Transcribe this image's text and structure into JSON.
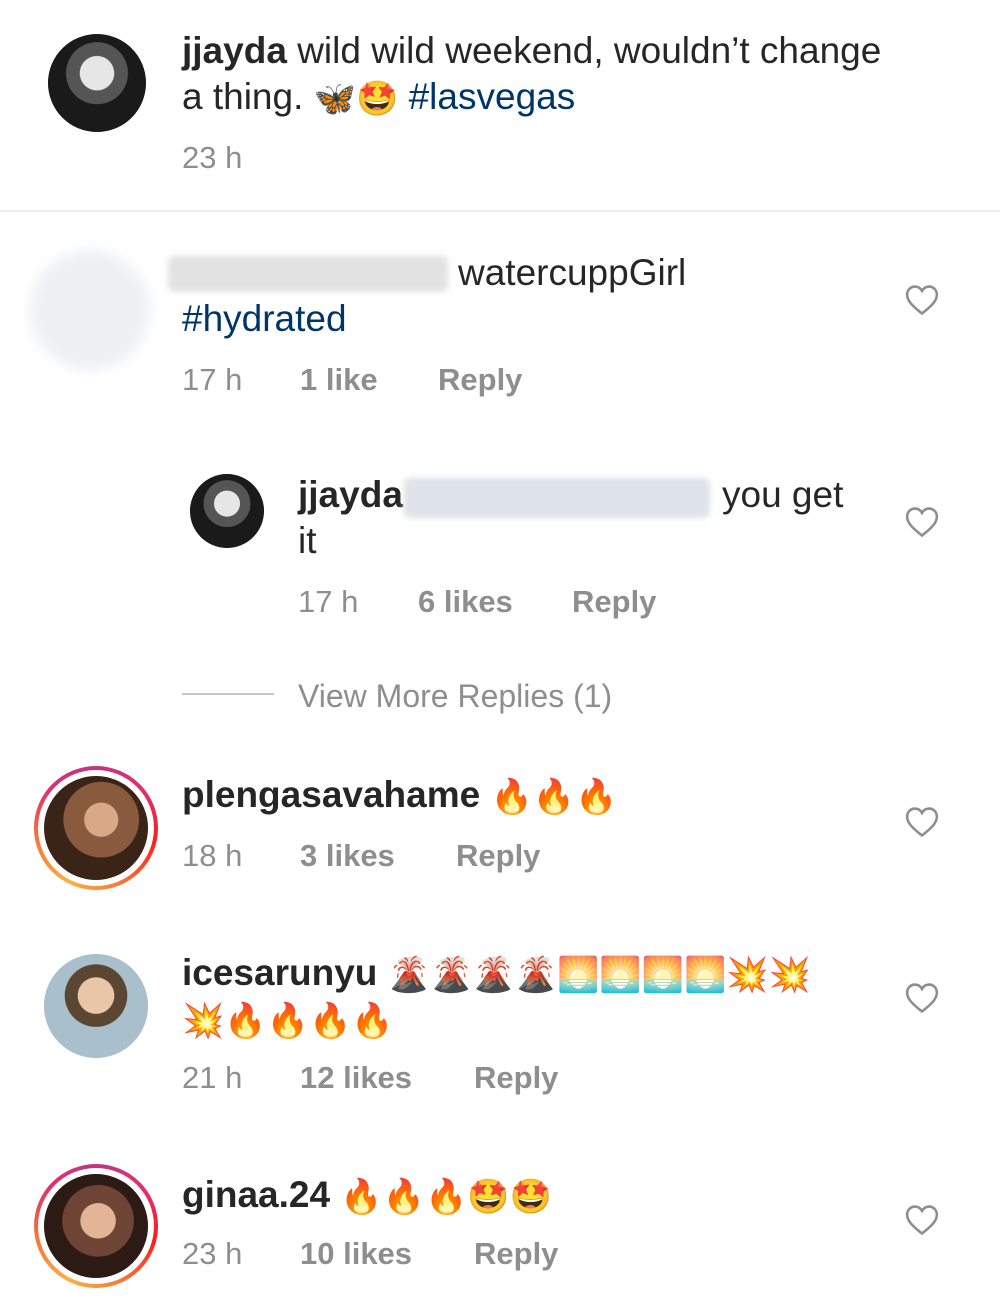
{
  "caption": {
    "username": "jjayda",
    "text_line1": "wild wild weekend, wouldn’t change",
    "text_line2": "a thing.",
    "emojis": "🦋🤩",
    "hashtag": "#lasvegas",
    "time": "23 h"
  },
  "comments": [
    {
      "username_hidden": true,
      "text": "watercuppGirl",
      "hashtag": "#hydrated",
      "time": "17 h",
      "likes": "1 like",
      "reply_label": "Reply"
    },
    {
      "username": "jjayda",
      "mention_hidden": true,
      "text_end": "you get",
      "text_line2": "it",
      "time": "17 h",
      "likes": "6 likes",
      "reply_label": "Reply"
    },
    {
      "username": "plengasavahame",
      "emojis": "🔥🔥🔥",
      "time": "18 h",
      "likes": "3 likes",
      "reply_label": "Reply"
    },
    {
      "username": "icesarunyu",
      "emojis_line1": "🌋🌋🌋🌋🌅🌅🌅🌅💥💥",
      "emojis_line2": "💥🔥🔥🔥🔥",
      "time": "21 h",
      "likes": "12 likes",
      "reply_label": "Reply"
    },
    {
      "username": "ginaa.24",
      "emojis": "🔥🔥🔥🤩🤩",
      "time": "23 h",
      "likes": "10 likes",
      "reply_label": "Reply"
    }
  ],
  "view_more_replies": "View More Replies (1)",
  "icons": {
    "like": "heart-outline-icon"
  },
  "colors": {
    "text": "#262626",
    "meta": "#8e8e8e",
    "hashtag": "#003569",
    "divider": "#efefef"
  }
}
